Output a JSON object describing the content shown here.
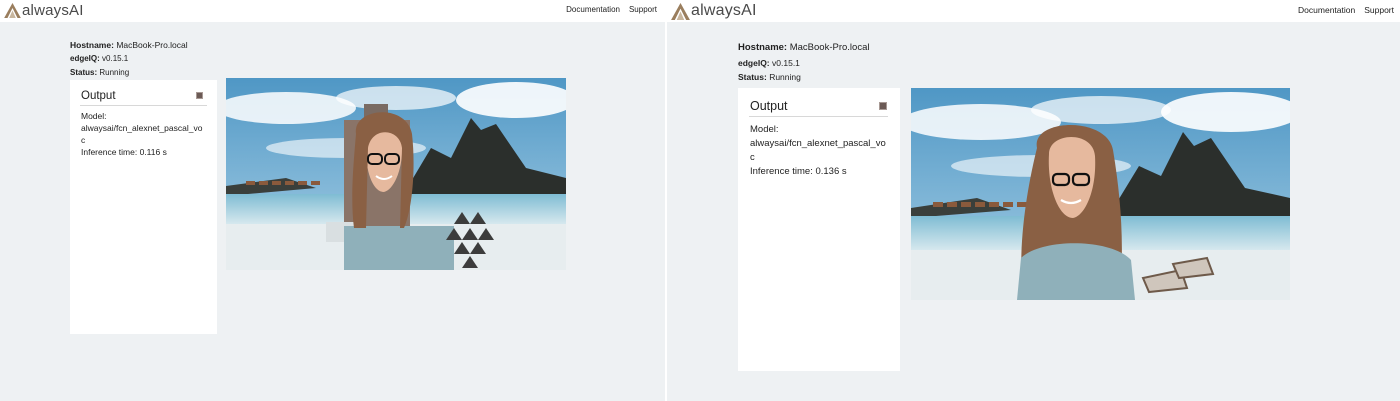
{
  "screens": [
    {
      "navbar": {
        "logo_text": "alwaysAI",
        "links": [
          "Documentation",
          "Support"
        ]
      },
      "info": {
        "hostname_label": "Hostname:",
        "hostname_value": "MacBook-Pro.local",
        "edgeiq_label": "edgeIQ:",
        "edgeiq_value": "v0.15.1",
        "status_label": "Status:",
        "status_value": "Running"
      },
      "output": {
        "title": "Output",
        "lines": [
          "Model:",
          "alwaysai/fcn_alexnet_pascal_vo",
          "c",
          "Inference time: 0.116 s"
        ]
      }
    },
    {
      "navbar": {
        "logo_text": "alwaysAI",
        "links": [
          "Documentation",
          "Support"
        ]
      },
      "info": {
        "hostname_label": "Hostname:",
        "hostname_value": "MacBook-Pro.local",
        "edgeiq_label": "edgeIQ:",
        "edgeiq_value": "v0.15.1",
        "status_label": "Status:",
        "status_value": "Running"
      },
      "output": {
        "title": "Output",
        "lines": [
          "Model:",
          "alwaysai/fcn_alexnet_pascal_vo",
          "c",
          "Inference time: 0.136 s"
        ]
      }
    }
  ],
  "colors": {
    "background": "#eef1f3",
    "card": "#ffffff",
    "logo_mark": "#9a7e5e",
    "sky": "#6aa9cf",
    "sea": "#8fc4d8",
    "sand": "#e9eef0",
    "mountain": "#2b2f2c"
  },
  "icons": {
    "logo": "alwaysai-logo-icon",
    "stop": "stop-square-icon"
  }
}
